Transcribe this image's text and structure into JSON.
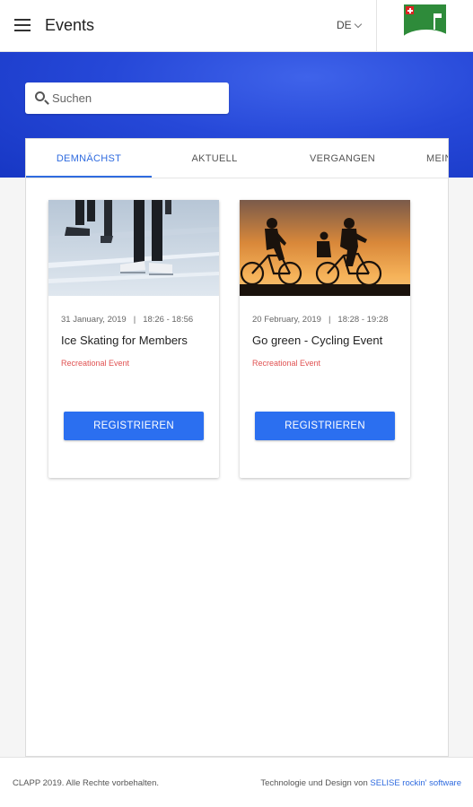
{
  "header": {
    "title": "Events",
    "language": "DE"
  },
  "search": {
    "placeholder": "Suchen",
    "value": ""
  },
  "tabs": [
    {
      "label": "DEMNÄCHST",
      "active": true
    },
    {
      "label": "AKTUELL",
      "active": false
    },
    {
      "label": "VERGANGEN",
      "active": false
    },
    {
      "label": "MEIN",
      "active": false
    }
  ],
  "events": [
    {
      "date": "31 January, 2019",
      "separator": "|",
      "time": "18:26 - 18:56",
      "title": "Ice Skating for Members",
      "category": "Recreational Event",
      "button_label": "REGISTRIEREN"
    },
    {
      "date": "20 February, 2019",
      "separator": "|",
      "time": "18:28 - 19:28",
      "title": "Go green - Cycling Event",
      "category": "Recreational Event",
      "button_label": "REGISTRIEREN"
    }
  ],
  "footer": {
    "copyright": "CLAPP 2019. Alle Rechte vorbehalten.",
    "credit_prefix": "Technologie und Design von",
    "credit_link": "SELISE rockin' software"
  },
  "colors": {
    "primary": "#2b6ff0",
    "hero": "#2648d8",
    "category": "#e05252",
    "active_tab": "#2f6bdf"
  },
  "icons": {
    "menu": "menu-icon",
    "search": "search-icon",
    "language": "chevron-down-icon",
    "logo": "club-logo"
  }
}
